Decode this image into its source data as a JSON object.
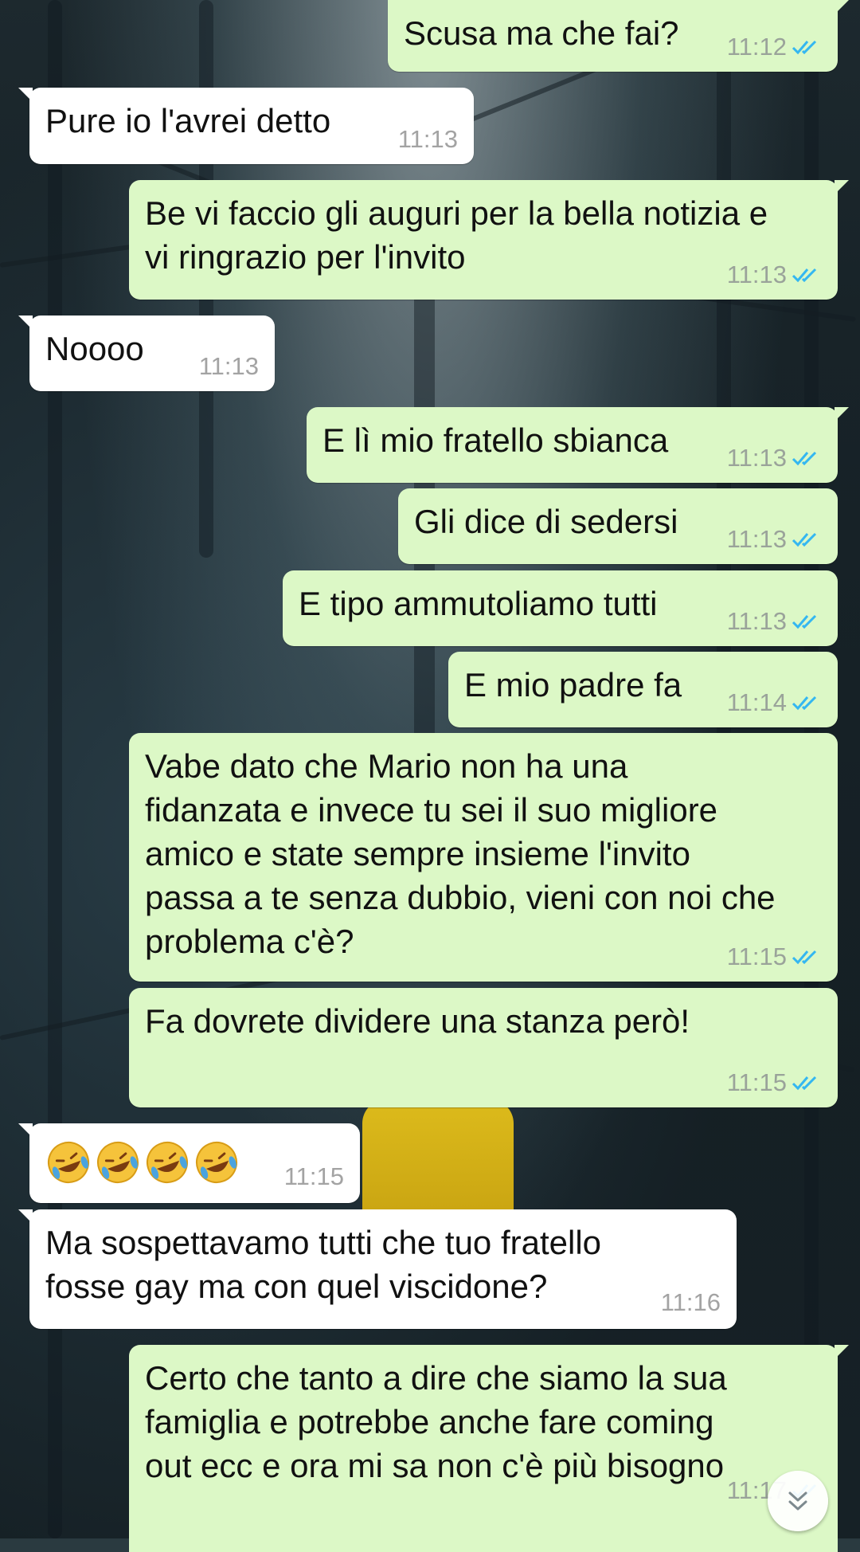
{
  "chat": {
    "messages": [
      {
        "id": "m1",
        "dir": "out",
        "text": "Scusa ma che fai?",
        "time": "11:12",
        "read": true
      },
      {
        "id": "m2",
        "dir": "in",
        "text": "Pure io l'avrei detto",
        "time": "11:13"
      },
      {
        "id": "m3",
        "dir": "out",
        "text": "Be vi faccio gli auguri per la bella notizia e\nvi ringrazio per l'invito",
        "time": "11:13",
        "read": true
      },
      {
        "id": "m4",
        "dir": "in",
        "text": "Noooo",
        "time": "11:13"
      },
      {
        "id": "m5",
        "dir": "out",
        "text": "E lì mio fratello sbianca",
        "time": "11:13",
        "read": true
      },
      {
        "id": "m6",
        "dir": "out",
        "text": "Gli dice di sedersi",
        "time": "11:13",
        "read": true
      },
      {
        "id": "m7",
        "dir": "out",
        "text": "E tipo ammutoliamo tutti",
        "time": "11:13",
        "read": true
      },
      {
        "id": "m8",
        "dir": "out",
        "text": "E mio padre fa",
        "time": "11:14",
        "read": true
      },
      {
        "id": "m9",
        "dir": "out",
        "text": "Vabe dato che Mario non ha una\nfidanzata e invece tu sei il suo migliore\namico e state sempre insieme l'invito\npassa a te senza dubbio, vieni con noi che\nproblema c'è?",
        "time": "11:15",
        "read": true
      },
      {
        "id": "m10",
        "dir": "out",
        "text": "Fa dovrete dividere una stanza però!",
        "time": "11:15",
        "read": true
      },
      {
        "id": "m11",
        "dir": "in",
        "emoji": [
          "rofl-emoji",
          "rofl-emoji",
          "rofl-emoji",
          "rofl-emoji"
        ],
        "time": "11:15"
      },
      {
        "id": "m12",
        "dir": "in",
        "text": "Ma sospettavamo tutti che tuo fratello\nfosse gay ma con quel viscidone?",
        "time": "11:16"
      },
      {
        "id": "m13",
        "dir": "out",
        "text": "Certo che tanto a dire che siamo la sua\nfamiglia e potrebbe anche fare coming\nout ecc e ora mi sa non c'è più bisogno",
        "time": "11:17",
        "read": true
      }
    ]
  },
  "icons": {
    "read_receipt": "double-check-icon",
    "scroll_down": "chevrons-down-icon",
    "emoji": "rofl-emoji"
  },
  "colors": {
    "outgoing_bubble": "#dcf8c6",
    "incoming_bubble": "#ffffff",
    "read_ticks": "#34b7f1",
    "timestamp": "#9aa39a"
  }
}
